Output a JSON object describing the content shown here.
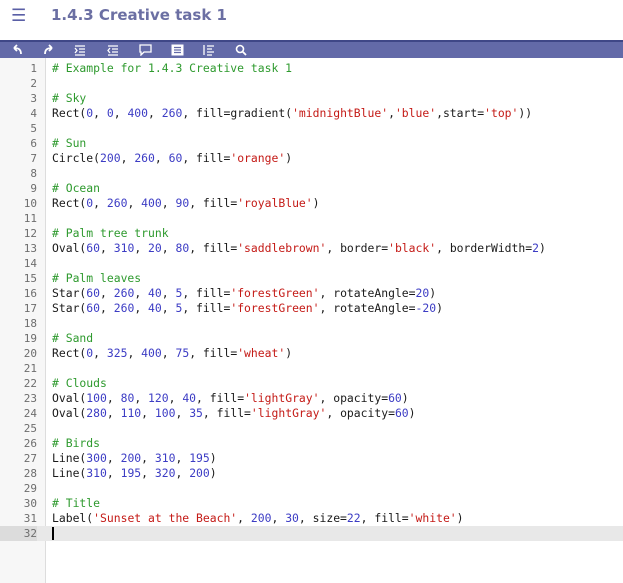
{
  "header": {
    "menu_icon": "hamburger-menu-icon",
    "title": "1.4.3 Creative task 1"
  },
  "toolbar": {
    "buttons": [
      {
        "name": "undo",
        "icon": "undo-icon"
      },
      {
        "name": "redo",
        "icon": "redo-icon"
      },
      {
        "name": "indent",
        "icon": "indent-icon"
      },
      {
        "name": "outdent",
        "icon": "outdent-icon"
      },
      {
        "name": "comment",
        "icon": "comment-icon"
      },
      {
        "name": "format",
        "icon": "format-icon"
      },
      {
        "name": "fold",
        "icon": "fold-icon"
      },
      {
        "name": "search",
        "icon": "search-icon"
      }
    ]
  },
  "colors": {
    "toolbar": "#636aa8",
    "comment": "#2e9a2e",
    "string": "#c41a16",
    "number": "#3c3cc4",
    "title": "#6b6fa3"
  },
  "editor": {
    "active_line": 32,
    "lines": [
      [
        [
          "c",
          "# Example for 1.4.3 Creative task 1"
        ]
      ],
      [],
      [
        [
          "c",
          "# Sky"
        ]
      ],
      [
        [
          "p",
          "Rect("
        ],
        [
          "n",
          "0"
        ],
        [
          "p",
          ", "
        ],
        [
          "n",
          "0"
        ],
        [
          "p",
          ", "
        ],
        [
          "n",
          "400"
        ],
        [
          "p",
          ", "
        ],
        [
          "n",
          "260"
        ],
        [
          "p",
          ", fill=gradient("
        ],
        [
          "s",
          "'midnightBlue'"
        ],
        [
          "p",
          ","
        ],
        [
          "s",
          "'blue'"
        ],
        [
          "p",
          ",start="
        ],
        [
          "s",
          "'top'"
        ],
        [
          "p",
          "))"
        ]
      ],
      [],
      [
        [
          "c",
          "# Sun"
        ]
      ],
      [
        [
          "p",
          "Circle("
        ],
        [
          "n",
          "200"
        ],
        [
          "p",
          ", "
        ],
        [
          "n",
          "260"
        ],
        [
          "p",
          ", "
        ],
        [
          "n",
          "60"
        ],
        [
          "p",
          ", fill="
        ],
        [
          "s",
          "'orange'"
        ],
        [
          "p",
          ")"
        ]
      ],
      [],
      [
        [
          "c",
          "# Ocean"
        ]
      ],
      [
        [
          "p",
          "Rect("
        ],
        [
          "n",
          "0"
        ],
        [
          "p",
          ", "
        ],
        [
          "n",
          "260"
        ],
        [
          "p",
          ", "
        ],
        [
          "n",
          "400"
        ],
        [
          "p",
          ", "
        ],
        [
          "n",
          "90"
        ],
        [
          "p",
          ", fill="
        ],
        [
          "s",
          "'royalBlue'"
        ],
        [
          "p",
          ")"
        ]
      ],
      [],
      [
        [
          "c",
          "# Palm tree trunk"
        ]
      ],
      [
        [
          "p",
          "Oval("
        ],
        [
          "n",
          "60"
        ],
        [
          "p",
          ", "
        ],
        [
          "n",
          "310"
        ],
        [
          "p",
          ", "
        ],
        [
          "n",
          "20"
        ],
        [
          "p",
          ", "
        ],
        [
          "n",
          "80"
        ],
        [
          "p",
          ", fill="
        ],
        [
          "s",
          "'saddlebrown'"
        ],
        [
          "p",
          ", border="
        ],
        [
          "s",
          "'black'"
        ],
        [
          "p",
          ", borderWidth="
        ],
        [
          "n",
          "2"
        ],
        [
          "p",
          ")"
        ]
      ],
      [],
      [
        [
          "c",
          "# Palm leaves"
        ]
      ],
      [
        [
          "p",
          "Star("
        ],
        [
          "n",
          "60"
        ],
        [
          "p",
          ", "
        ],
        [
          "n",
          "260"
        ],
        [
          "p",
          ", "
        ],
        [
          "n",
          "40"
        ],
        [
          "p",
          ", "
        ],
        [
          "n",
          "5"
        ],
        [
          "p",
          ", fill="
        ],
        [
          "s",
          "'forestGreen'"
        ],
        [
          "p",
          ", rotateAngle="
        ],
        [
          "n",
          "20"
        ],
        [
          "p",
          ")"
        ]
      ],
      [
        [
          "p",
          "Star("
        ],
        [
          "n",
          "60"
        ],
        [
          "p",
          ", "
        ],
        [
          "n",
          "260"
        ],
        [
          "p",
          ", "
        ],
        [
          "n",
          "40"
        ],
        [
          "p",
          ", "
        ],
        [
          "n",
          "5"
        ],
        [
          "p",
          ", fill="
        ],
        [
          "s",
          "'forestGreen'"
        ],
        [
          "p",
          ", rotateAngle="
        ],
        [
          "n",
          "-20"
        ],
        [
          "p",
          ")"
        ]
      ],
      [],
      [
        [
          "c",
          "# Sand"
        ]
      ],
      [
        [
          "p",
          "Rect("
        ],
        [
          "n",
          "0"
        ],
        [
          "p",
          ", "
        ],
        [
          "n",
          "325"
        ],
        [
          "p",
          ", "
        ],
        [
          "n",
          "400"
        ],
        [
          "p",
          ", "
        ],
        [
          "n",
          "75"
        ],
        [
          "p",
          ", fill="
        ],
        [
          "s",
          "'wheat'"
        ],
        [
          "p",
          ")"
        ]
      ],
      [],
      [
        [
          "c",
          "# Clouds"
        ]
      ],
      [
        [
          "p",
          "Oval("
        ],
        [
          "n",
          "100"
        ],
        [
          "p",
          ", "
        ],
        [
          "n",
          "80"
        ],
        [
          "p",
          ", "
        ],
        [
          "n",
          "120"
        ],
        [
          "p",
          ", "
        ],
        [
          "n",
          "40"
        ],
        [
          "p",
          ", fill="
        ],
        [
          "s",
          "'lightGray'"
        ],
        [
          "p",
          ", opacity="
        ],
        [
          "n",
          "60"
        ],
        [
          "p",
          ")"
        ]
      ],
      [
        [
          "p",
          "Oval("
        ],
        [
          "n",
          "280"
        ],
        [
          "p",
          ", "
        ],
        [
          "n",
          "110"
        ],
        [
          "p",
          ", "
        ],
        [
          "n",
          "100"
        ],
        [
          "p",
          ", "
        ],
        [
          "n",
          "35"
        ],
        [
          "p",
          ", fill="
        ],
        [
          "s",
          "'lightGray'"
        ],
        [
          "p",
          ", opacity="
        ],
        [
          "n",
          "60"
        ],
        [
          "p",
          ")"
        ]
      ],
      [],
      [
        [
          "c",
          "# Birds"
        ]
      ],
      [
        [
          "p",
          "Line("
        ],
        [
          "n",
          "300"
        ],
        [
          "p",
          ", "
        ],
        [
          "n",
          "200"
        ],
        [
          "p",
          ", "
        ],
        [
          "n",
          "310"
        ],
        [
          "p",
          ", "
        ],
        [
          "n",
          "195"
        ],
        [
          "p",
          ")"
        ]
      ],
      [
        [
          "p",
          "Line("
        ],
        [
          "n",
          "310"
        ],
        [
          "p",
          ", "
        ],
        [
          "n",
          "195"
        ],
        [
          "p",
          ", "
        ],
        [
          "n",
          "320"
        ],
        [
          "p",
          ", "
        ],
        [
          "n",
          "200"
        ],
        [
          "p",
          ")"
        ]
      ],
      [],
      [
        [
          "c",
          "# Title"
        ]
      ],
      [
        [
          "p",
          "Label("
        ],
        [
          "s",
          "'Sunset at the Beach'"
        ],
        [
          "p",
          ", "
        ],
        [
          "n",
          "200"
        ],
        [
          "p",
          ", "
        ],
        [
          "n",
          "30"
        ],
        [
          "p",
          ", size="
        ],
        [
          "n",
          "22"
        ],
        [
          "p",
          ", fill="
        ],
        [
          "s",
          "'white'"
        ],
        [
          "p",
          ")"
        ]
      ],
      []
    ]
  }
}
